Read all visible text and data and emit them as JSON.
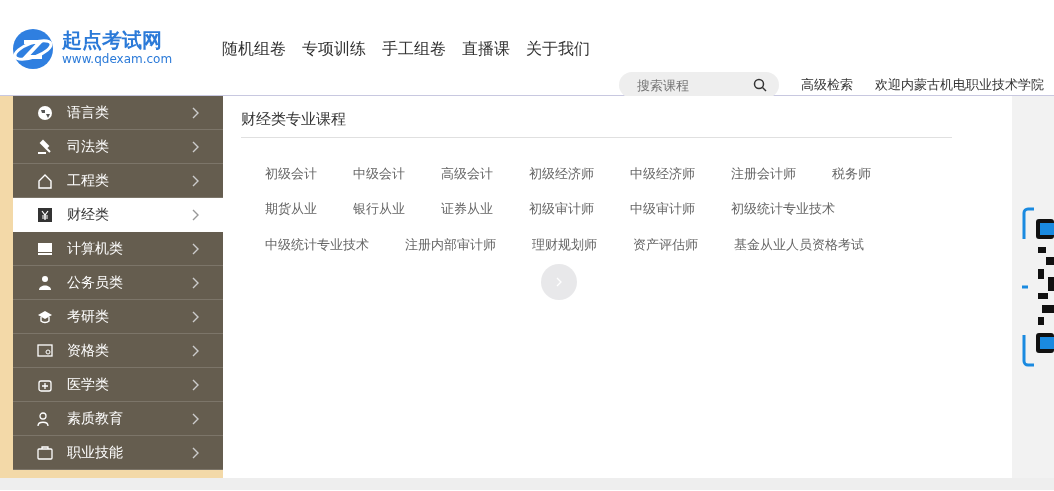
{
  "logo": {
    "name": "起点考试网",
    "url": "www.qdexam.com"
  },
  "nav": [
    {
      "label": "随机组卷"
    },
    {
      "label": "专项训练"
    },
    {
      "label": "手工组卷"
    },
    {
      "label": "直播课"
    },
    {
      "label": "关于我们"
    }
  ],
  "search": {
    "placeholder": "搜索课程"
  },
  "advanced_search": "高级检索",
  "welcome": "欢迎内蒙古机电职业技术学院",
  "sidebar": {
    "items": [
      {
        "label": "语言类",
        "selected": false
      },
      {
        "label": "司法类",
        "selected": false
      },
      {
        "label": "工程类",
        "selected": false
      },
      {
        "label": "财经类",
        "selected": true
      },
      {
        "label": "计算机类",
        "selected": false
      },
      {
        "label": "公务员类",
        "selected": false
      },
      {
        "label": "考研类",
        "selected": false
      },
      {
        "label": "资格类",
        "selected": false
      },
      {
        "label": "医学类",
        "selected": false
      },
      {
        "label": "素质教育",
        "selected": false
      },
      {
        "label": "职业技能",
        "selected": false
      }
    ]
  },
  "panel": {
    "title": "财经类专业课程",
    "courses": [
      "初级会计",
      "中级会计",
      "高级会计",
      "初级经济师",
      "中级经济师",
      "注册会计师",
      "税务师",
      "期货从业",
      "银行从业",
      "证券从业",
      "初级审计师",
      "中级审计师",
      "初级统计专业技术",
      "中级统计专业技术",
      "注册内部审计师",
      "理财规划师",
      "资产评估师",
      "基金从业人员资格考试"
    ]
  }
}
